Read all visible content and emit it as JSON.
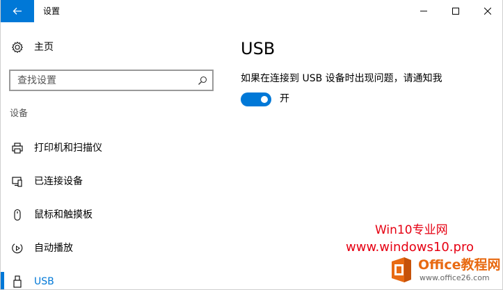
{
  "window": {
    "title": "设置"
  },
  "sidebar": {
    "home_label": "主页",
    "search_placeholder": "查找设置",
    "section_heading": "设备",
    "items": [
      {
        "label": "打印机和扫描仪",
        "icon": "printer-icon"
      },
      {
        "label": "已连接设备",
        "icon": "connected-devices-icon"
      },
      {
        "label": "鼠标和触摸板",
        "icon": "mouse-icon"
      },
      {
        "label": "自动播放",
        "icon": "autoplay-icon"
      },
      {
        "label": "USB",
        "icon": "usb-icon",
        "selected": true
      }
    ]
  },
  "content": {
    "page_title": "USB",
    "setting_label": "如果在连接到 USB 设备时出现问题，请通知我",
    "toggle_on": true,
    "toggle_state_label": "开"
  },
  "watermark": {
    "line1": "Win10专业网",
    "line2": "www.windows10.pro",
    "brand_name": "Office教程网",
    "brand_url": "www.office26.com"
  },
  "colors": {
    "accent": "#0078d7",
    "watermark_red": "#e60012",
    "brand_orange": "#e86a12"
  }
}
